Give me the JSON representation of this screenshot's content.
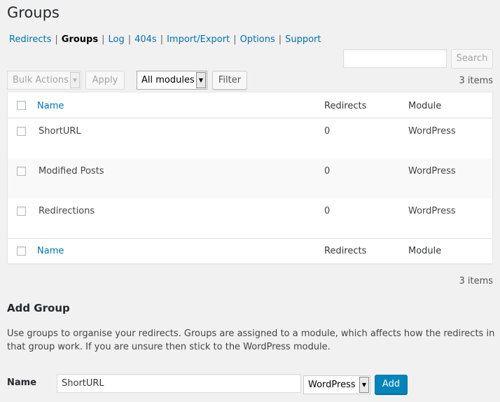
{
  "page": {
    "title": "Groups"
  },
  "subnav": [
    {
      "label": "Redirects",
      "current": false
    },
    {
      "label": "Groups",
      "current": true
    },
    {
      "label": "Log",
      "current": false
    },
    {
      "label": "404s",
      "current": false
    },
    {
      "label": "Import/Export",
      "current": false
    },
    {
      "label": "Options",
      "current": false
    },
    {
      "label": "Support",
      "current": false
    }
  ],
  "search": {
    "value": "",
    "button": "Search"
  },
  "toolbar": {
    "bulk_actions": "Bulk Actions",
    "apply": "Apply",
    "module_filter": "All modules",
    "filter": "Filter",
    "items_count": "3 items"
  },
  "table": {
    "columns": {
      "name": "Name",
      "redirects": "Redirects",
      "module": "Module"
    },
    "rows": [
      {
        "name": "ShortURL",
        "redirects": "0",
        "module": "WordPress"
      },
      {
        "name": "Modified Posts",
        "redirects": "0",
        "module": "WordPress"
      },
      {
        "name": "Redirections",
        "redirects": "0",
        "module": "WordPress"
      }
    ]
  },
  "bottom": {
    "items_count": "3 items"
  },
  "add_group": {
    "heading": "Add Group",
    "description": "Use groups to organise your redirects. Groups are assigned to a module, which affects how the redirects in that group work. If you are unsure then stick to the WordPress module.",
    "name_label": "Name",
    "name_value": "ShortURL",
    "module_value": "WordPress",
    "add_button": "Add"
  },
  "colors": {
    "link": "#0073aa",
    "primary_button": "#0085ba",
    "background": "#f1f1f1"
  },
  "icons": {
    "dropdown": "triangle-down-icon"
  }
}
